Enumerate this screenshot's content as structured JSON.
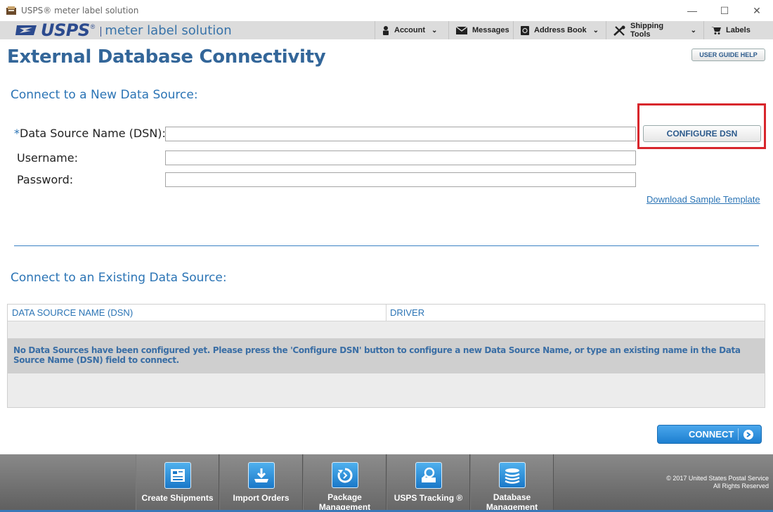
{
  "window": {
    "title": "USPS® meter label solution",
    "controls": {
      "minimize": "—",
      "maximize": "☐",
      "close": "✕"
    }
  },
  "header": {
    "logo_text": "USPS",
    "logo_reg": "®",
    "product_name": "meter label solution",
    "menu": [
      {
        "label": "Account",
        "icon": "person-icon",
        "has_dropdown": true
      },
      {
        "label": "Messages",
        "icon": "envelope-icon",
        "has_dropdown": false
      },
      {
        "label": "Address Book",
        "icon": "address-book-icon",
        "has_dropdown": true
      },
      {
        "label": "Shipping Tools",
        "icon": "tools-icon",
        "has_dropdown": true
      },
      {
        "label": "Labels",
        "icon": "cart-icon",
        "has_dropdown": false
      }
    ],
    "chevron": "⌄"
  },
  "page": {
    "title": "External Database Connectivity",
    "help_button": "USER GUIDE HELP"
  },
  "new_source": {
    "section_title": "Connect to a New Data Source:",
    "required_mark": "*",
    "dsn_label": "Data Source Name (DSN):",
    "dsn_value": "",
    "username_label": "Username:",
    "username_value": "",
    "password_label": "Password:",
    "password_value": "",
    "configure_button": "CONFIGURE DSN",
    "download_link": "Download Sample Template"
  },
  "existing_source": {
    "section_title": "Connect to an Existing Data Source:",
    "columns": [
      "DATA SOURCE NAME (DSN)",
      "DRIVER"
    ],
    "empty_message": "No Data Sources have been configured yet. Please press the 'Configure DSN' button to configure a new Data Source Name, or type an existing name in the Data Source Name (DSN) field to connect."
  },
  "connect_button": "CONNECT",
  "bottom_nav": [
    {
      "label": "Create Shipments",
      "icon": "create-shipments-icon"
    },
    {
      "label": "Import Orders",
      "icon": "import-orders-icon"
    },
    {
      "label": "Package Management",
      "icon": "package-management-icon"
    },
    {
      "label": "USPS Tracking ®",
      "icon": "tracking-icon"
    },
    {
      "label": "Database Management",
      "icon": "database-icon"
    }
  ],
  "copyright": {
    "line1": "© 2017 United States Postal Service",
    "line2": "All Rights Reserved"
  },
  "colors": {
    "accent": "#336699",
    "link": "#2b74b5",
    "highlight": "#d8262c",
    "connect": "#1d7fd0"
  }
}
